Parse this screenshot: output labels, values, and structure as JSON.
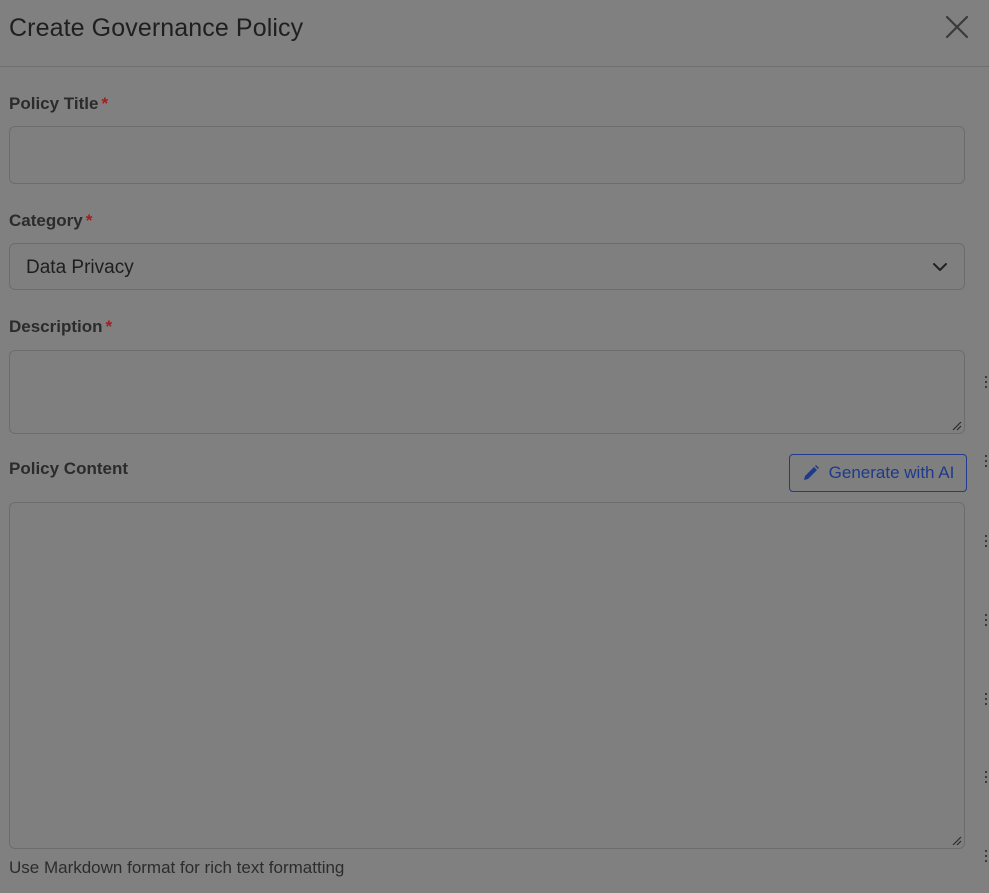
{
  "modal": {
    "title": "Create Governance Policy"
  },
  "form": {
    "policy_title": {
      "label": "Policy Title",
      "required_marker": "*",
      "value": "",
      "placeholder": ""
    },
    "category": {
      "label": "Category",
      "required_marker": "*",
      "selected": "Data Privacy"
    },
    "description": {
      "label": "Description",
      "required_marker": "*",
      "value": ""
    },
    "policy_content": {
      "label": "Policy Content",
      "value": "",
      "hint": "Use Markdown format for rich text formatting"
    },
    "generate_ai_button": {
      "label": "Generate with AI",
      "icon": "pencil-icon"
    }
  },
  "icons": {
    "close": "close-icon",
    "chevron": "chevron-down-icon",
    "resize": "resize-handle-icon"
  },
  "colors": {
    "overlay": "#808080",
    "required": "#a51c1c",
    "accent": "#1d3a8c"
  }
}
